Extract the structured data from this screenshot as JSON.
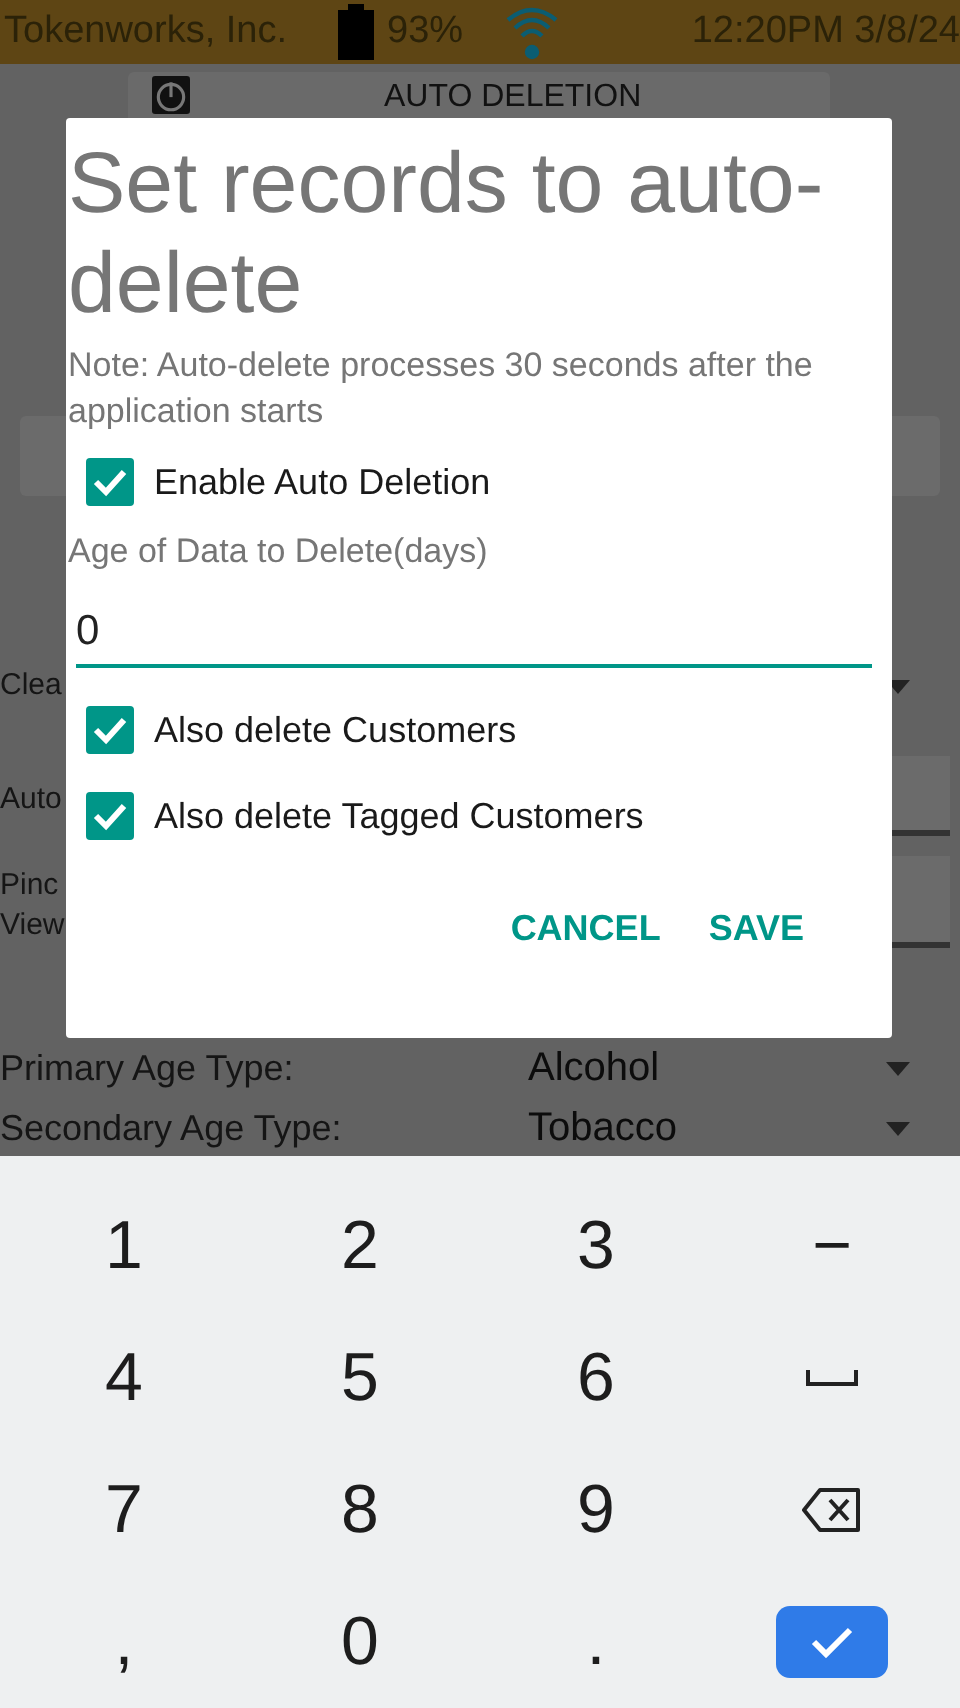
{
  "status_bar": {
    "carrier": "Tokenworks, Inc.",
    "battery": "93%",
    "time": "12:20PM 3/8/24"
  },
  "background": {
    "header_button": {
      "label": "AUTO DELETION"
    },
    "rows": [
      {
        "kind": "dropdown",
        "label": [
          "Clea"
        ]
      },
      {
        "kind": "field",
        "label": [
          "Auto"
        ]
      },
      {
        "kind": "field",
        "label": [
          "Pinc",
          "View"
        ]
      },
      {
        "kind": "dropdown",
        "label": [
          "Primary Age Type:"
        ],
        "value": "Alcohol"
      },
      {
        "kind": "dropdown",
        "label": [
          "Secondary Age Type:"
        ],
        "value": "Tobacco"
      }
    ]
  },
  "dialog": {
    "title": "Set records to auto-delete",
    "note": "Note: Auto-delete processes 30 seconds after the application starts",
    "enable": {
      "label": "Enable Auto Deletion",
      "checked": true
    },
    "age_label": "Age of Data to Delete(days)",
    "age_value": "0",
    "options": [
      {
        "label": "Also delete Customers",
        "checked": true
      },
      {
        "label": "Also delete Tagged Customers",
        "checked": true
      }
    ],
    "buttons": [
      "CANCEL",
      "SAVE"
    ]
  },
  "keyboard": {
    "keys": [
      {
        "kind": "char",
        "label": "1"
      },
      {
        "kind": "char",
        "label": "2"
      },
      {
        "kind": "char",
        "label": "3"
      },
      {
        "kind": "char",
        "label": "−"
      },
      {
        "kind": "char",
        "label": "4"
      },
      {
        "kind": "char",
        "label": "5"
      },
      {
        "kind": "char",
        "label": "6"
      },
      {
        "kind": "space"
      },
      {
        "kind": "char",
        "label": "7"
      },
      {
        "kind": "char",
        "label": "8"
      },
      {
        "kind": "char",
        "label": "9"
      },
      {
        "kind": "backspace"
      },
      {
        "kind": "char",
        "label": ","
      },
      {
        "kind": "char",
        "label": "0"
      },
      {
        "kind": "char",
        "label": "."
      },
      {
        "kind": "done"
      }
    ]
  }
}
